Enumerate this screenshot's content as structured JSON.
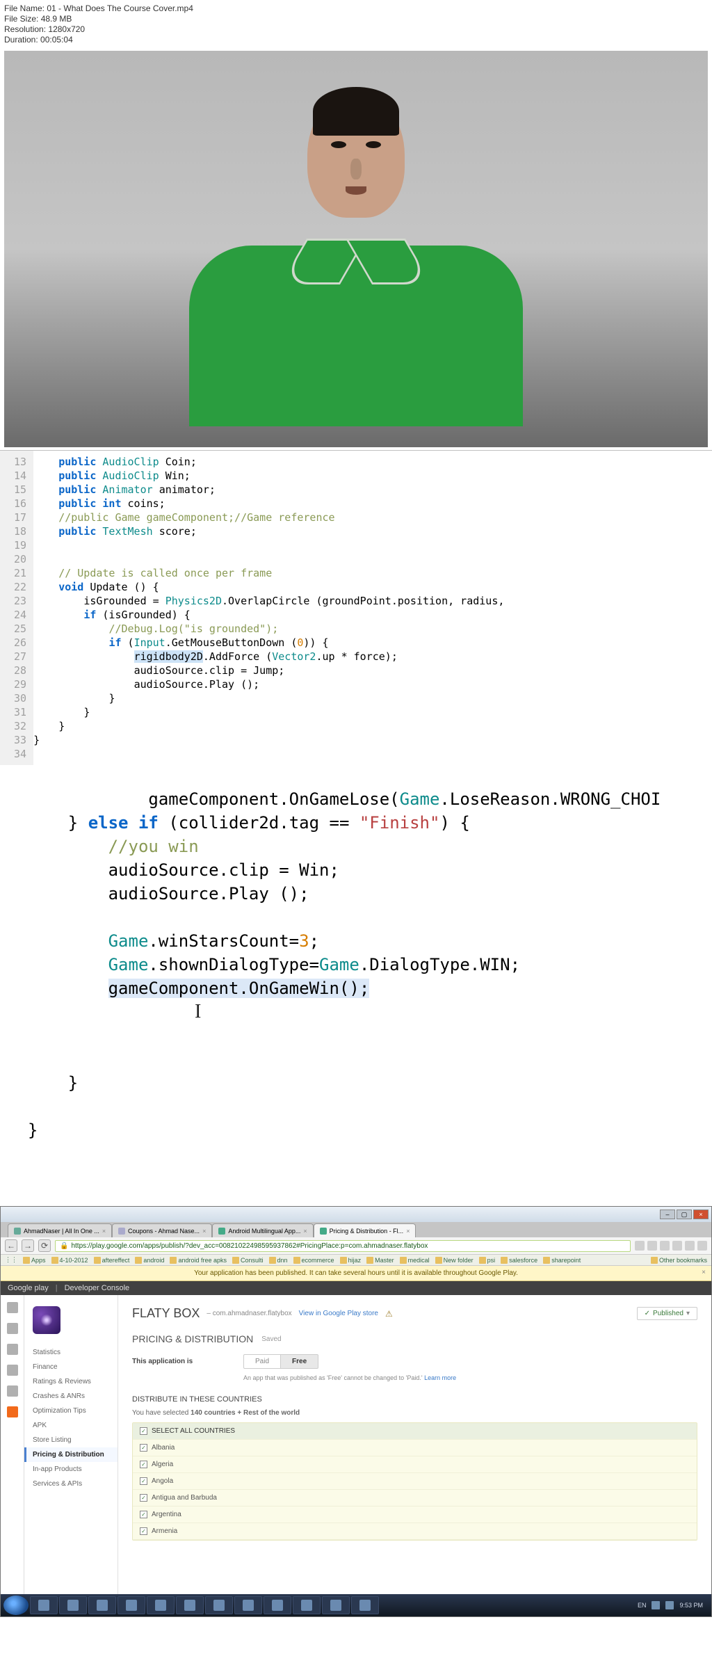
{
  "metadata": {
    "filename_label": "File Name:",
    "filename": "01 - What Does The Course Cover.mp4",
    "filesize_label": "File Size:",
    "filesize": "48.9 MB",
    "resolution_label": "Resolution:",
    "resolution": "1280x720",
    "duration_label": "Duration:",
    "duration": "00:05:04"
  },
  "code1": {
    "line_start": 13,
    "line_end": 34,
    "lines": [
      {
        "n": 13,
        "i": 1,
        "t": [
          {
            "kw": "public"
          },
          {
            "sp": " "
          },
          {
            "typ": "AudioClip"
          },
          {
            "sp": " "
          },
          {
            "p": "Coin;"
          }
        ]
      },
      {
        "n": 14,
        "i": 1,
        "t": [
          {
            "kw": "public"
          },
          {
            "sp": " "
          },
          {
            "typ": "AudioClip"
          },
          {
            "sp": " "
          },
          {
            "p": "Win;"
          }
        ]
      },
      {
        "n": 15,
        "i": 1,
        "t": [
          {
            "kw": "public"
          },
          {
            "sp": " "
          },
          {
            "typ": "Animator"
          },
          {
            "sp": " "
          },
          {
            "p": "animator;"
          }
        ]
      },
      {
        "n": 16,
        "i": 1,
        "t": [
          {
            "kw": "public"
          },
          {
            "sp": " "
          },
          {
            "kw": "int"
          },
          {
            "sp": " "
          },
          {
            "p": "coins;"
          }
        ]
      },
      {
        "n": 17,
        "i": 1,
        "t": [
          {
            "cmn": "//public Game gameComponent;//Game reference"
          }
        ]
      },
      {
        "n": 18,
        "i": 1,
        "t": [
          {
            "kw": "public"
          },
          {
            "sp": " "
          },
          {
            "typ": "TextMesh"
          },
          {
            "sp": " "
          },
          {
            "p": "score;"
          }
        ]
      },
      {
        "n": 19,
        "i": 0,
        "t": []
      },
      {
        "n": 20,
        "i": 0,
        "t": []
      },
      {
        "n": 21,
        "i": 1,
        "t": [
          {
            "cmn": "// Update is called once per frame"
          }
        ]
      },
      {
        "n": 22,
        "i": 1,
        "t": [
          {
            "kw": "void"
          },
          {
            "sp": " "
          },
          {
            "p": "Update () {"
          }
        ]
      },
      {
        "n": 23,
        "i": 2,
        "t": [
          {
            "p": "isGrounded = "
          },
          {
            "typ": "Physics2D"
          },
          {
            "p": ".OverlapCircle (groundPoint.position, radius, "
          }
        ]
      },
      {
        "n": 24,
        "i": 2,
        "t": [
          {
            "kw": "if"
          },
          {
            "sp": " "
          },
          {
            "p": "(isGrounded) {"
          }
        ]
      },
      {
        "n": 25,
        "i": 3,
        "t": [
          {
            "cmn": "//Debug.Log(\"is grounded\");"
          }
        ]
      },
      {
        "n": 26,
        "i": 3,
        "t": [
          {
            "kw": "if"
          },
          {
            "sp": " "
          },
          {
            "p": "("
          },
          {
            "typ": "Input"
          },
          {
            "p": ".GetMouseButtonDown ("
          },
          {
            "num": "0"
          },
          {
            "p": ")) {"
          }
        ]
      },
      {
        "n": 27,
        "i": 4,
        "t": [
          {
            "sel": "rigidbody2D"
          },
          {
            "p": ".AddForce ("
          },
          {
            "typ": "Vector2"
          },
          {
            "p": ".up * force);"
          }
        ]
      },
      {
        "n": 28,
        "i": 4,
        "t": [
          {
            "p": "audioSource.clip = Jump;"
          }
        ]
      },
      {
        "n": 29,
        "i": 4,
        "t": [
          {
            "p": "audioSource.Play ();"
          }
        ]
      },
      {
        "n": 30,
        "i": 3,
        "t": [
          {
            "p": "}"
          }
        ]
      },
      {
        "n": 31,
        "i": 2,
        "t": [
          {
            "p": "}"
          }
        ]
      },
      {
        "n": 32,
        "i": 1,
        "t": [
          {
            "p": "}"
          }
        ]
      },
      {
        "n": 33,
        "i": 0,
        "t": [
          {
            "p": "}"
          }
        ]
      },
      {
        "n": 34,
        "i": 0,
        "t": []
      }
    ]
  },
  "code2": {
    "lines": [
      {
        "i": 3,
        "t": [
          {
            "p": "gameComponent.OnGameLose("
          },
          {
            "typ": "Game"
          },
          {
            "p": ".LoseReason.WRONG_CHOI"
          }
        ]
      },
      {
        "i": 1,
        "t": [
          {
            "p": "} "
          },
          {
            "kw": "else if"
          },
          {
            "sp": " "
          },
          {
            "p": "(collider2d.tag == "
          },
          {
            "str": "\"Finish\""
          },
          {
            "p": ") {"
          }
        ]
      },
      {
        "i": 2,
        "t": [
          {
            "cmn": "//you win"
          }
        ]
      },
      {
        "i": 2,
        "t": [
          {
            "p": "audioSource.clip = Win;"
          }
        ]
      },
      {
        "i": 2,
        "t": [
          {
            "p": "audioSource.Play ();"
          }
        ]
      },
      {
        "i": 0,
        "t": []
      },
      {
        "i": 2,
        "t": [
          {
            "typ": "Game"
          },
          {
            "p": ".winStarsCount="
          },
          {
            "num": "3"
          },
          {
            "p": ";"
          }
        ]
      },
      {
        "i": 2,
        "t": [
          {
            "typ": "Game"
          },
          {
            "p": ".shownDialogType="
          },
          {
            "typ": "Game"
          },
          {
            "p": ".DialogType.WIN;"
          }
        ]
      },
      {
        "i": 2,
        "t": [
          {
            "hl": "gameComponent.OnGameWin();"
          }
        ]
      }
    ],
    "trailing": [
      "",
      "",
      "    }",
      "",
      "}"
    ]
  },
  "browser": {
    "tabs": [
      {
        "label": "AhmadNaser | All In One ...",
        "icon": "#6a9"
      },
      {
        "label": "Coupons - Ahmad Nase...",
        "icon": "#aac"
      },
      {
        "label": "Android Multilingual App...",
        "icon": "#4a8"
      },
      {
        "label": "Pricing & Distribution - Fl...",
        "icon": "#4a8",
        "active": true
      }
    ],
    "url": "https://play.google.com/apps/publish/?dev_acc=00821022498595937862#PricingPlace:p=com.ahmadnaser.flatybox",
    "bookmarks": [
      "Apps",
      "4-10-2012",
      "aftereffect",
      "android",
      "android free apks",
      "Consulti",
      "dnn",
      "ecommerce",
      "hijaz",
      "Master",
      "medical",
      "New folder",
      "psi",
      "salesforce",
      "sharepoint"
    ],
    "other_bookmarks": "Other bookmarks",
    "notice": "Your application has been published. It can take several hours until it is available throughout Google Play.",
    "console_brand": "Google play",
    "console_sub": "Developer Console"
  },
  "play": {
    "nav": [
      "Statistics",
      "Finance",
      "Ratings & Reviews",
      "Crashes & ANRs",
      "Optimization Tips",
      "APK",
      "Store Listing",
      "Pricing & Distribution",
      "In-app Products",
      "Services & APIs"
    ],
    "nav_active": "Pricing & Distribution",
    "app_title": "FLATY BOX",
    "app_package": "– com.ahmadnaser.flatybox",
    "view_link": "View in Google Play store",
    "published": "Published",
    "section": "PRICING & DISTRIBUTION",
    "saved": "Saved",
    "pricing_label": "This application is",
    "paid": "Paid",
    "free": "Free",
    "help_text": "An app that was published as 'Free' cannot be changed to 'Paid.'",
    "learn_more": "Learn more",
    "distribute_hdr": "DISTRIBUTE IN THESE COUNTRIES",
    "selected_text_a": "You have selected ",
    "selected_text_b": "140 countries + Rest of the world",
    "select_all": "SELECT ALL COUNTRIES",
    "countries": [
      "Albania",
      "Algeria",
      "Angola",
      "Antigua and Barbuda",
      "Argentina",
      "Armenia"
    ]
  },
  "tray": {
    "lang": "EN",
    "time": "9:53 PM"
  }
}
